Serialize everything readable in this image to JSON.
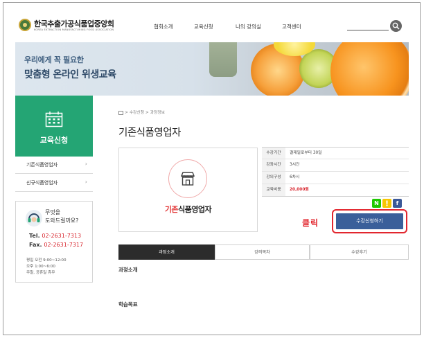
{
  "header": {
    "org_name": "한국추출가공식품업중앙회",
    "org_subtitle": "KOREA EXTRACTION MANUFACTURING FOOD ASSOCIATION",
    "nav": [
      "협회소개",
      "교육신청",
      "나의 강의실",
      "고객센터"
    ],
    "search_icon": "search-icon"
  },
  "banner": {
    "line1": "우리에게 꼭 필요한",
    "line2": "맞춤형 온라인 위생교육"
  },
  "sidebar": {
    "title": "교육신청",
    "items": [
      {
        "label": "기존식품영업자",
        "arrow": "›"
      },
      {
        "label": "신규식품영업자",
        "arrow": "›"
      }
    ]
  },
  "help": {
    "q1": "무엇을",
    "q2": "도와드릴까요?",
    "tel_label": "Tel.",
    "tel": "02-2631-7313",
    "fax_label": "Fax.",
    "fax": "02-2631-7317",
    "hours": [
      "평일 오전 9:00~12:00",
      "오후 1:00~6:00",
      "주말, 공휴일 휴무"
    ]
  },
  "main": {
    "breadcrumb": "> 수강신청 > 과정정보",
    "title": "기존식품영업자",
    "course_name_highlight": "기존",
    "course_name_rest": "식품영업자",
    "info": [
      {
        "key": "수강기간",
        "value": "결제일로부터 30일"
      },
      {
        "key": "강좌시간",
        "value": "3시간"
      },
      {
        "key": "강의구성",
        "value": "6차시"
      },
      {
        "key": "교육비용",
        "value": "20,000원"
      }
    ],
    "share": [
      "N",
      "",
      "f"
    ],
    "click_label": "클릭",
    "apply_button": "수강신청하기",
    "tabs": [
      "과정소개",
      "강의목차",
      "수강후기"
    ],
    "section1": "과정소개",
    "section2": "학습목표"
  },
  "colors": {
    "green": "#24a574",
    "red": "#e2262e",
    "button_blue": "#3a5f9a",
    "naver": "#1ec800",
    "kakao": "#f7c600",
    "facebook": "#3b5998"
  }
}
